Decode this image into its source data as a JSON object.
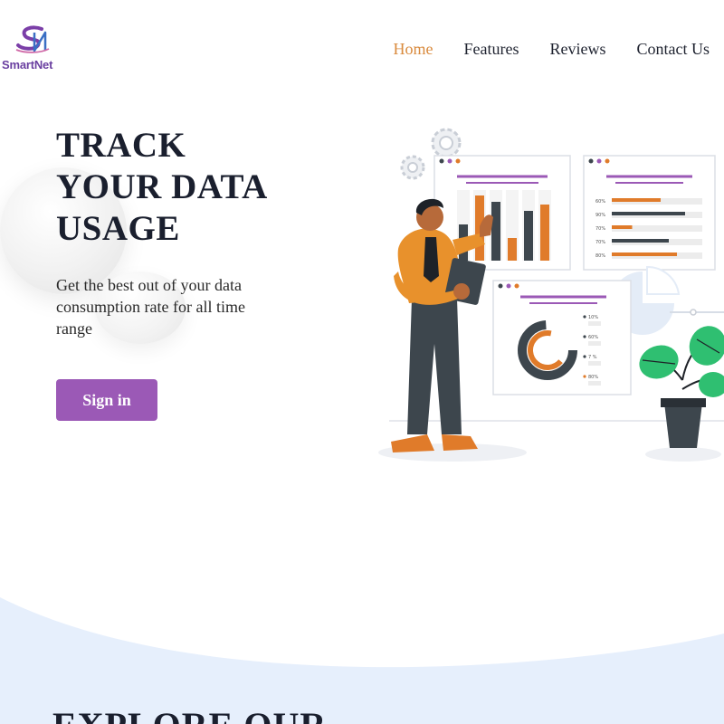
{
  "brand": {
    "name": "SmartNet",
    "logo_icon": "sn-monogram-icon",
    "colors": {
      "purple": "#9b59b6",
      "orange": "#e07b2a",
      "dark": "#3d464d"
    }
  },
  "nav": {
    "items": [
      {
        "label": "Home",
        "active": true
      },
      {
        "label": "Features",
        "active": false
      },
      {
        "label": "Reviews",
        "active": false
      },
      {
        "label": "Contact Us",
        "active": false
      }
    ]
  },
  "hero": {
    "title_lines": [
      "TRACK",
      "YOUR DATA",
      "USAGE"
    ],
    "subtitle": "Get the best out of your data consumption rate for all time range",
    "cta_label": "Sign in",
    "illustration": {
      "bars_panel": {
        "values": [
          40,
          72,
          65,
          25,
          55,
          62
        ]
      },
      "progress_panel": {
        "rows": [
          {
            "label": "60%",
            "value": 0.6,
            "color": "orange"
          },
          {
            "label": "90%",
            "value": 0.9,
            "color": "dark"
          },
          {
            "label": "70%",
            "value": 0.25,
            "color": "orange"
          },
          {
            "label": "70%",
            "value": 0.7,
            "color": "dark"
          },
          {
            "label": "80%",
            "value": 0.8,
            "color": "orange"
          }
        ]
      },
      "donut_panel": {
        "legend": [
          "10%",
          "60%",
          "7 %",
          "80%"
        ]
      }
    }
  },
  "next_section": {
    "title": "EXPLORE OUR"
  }
}
